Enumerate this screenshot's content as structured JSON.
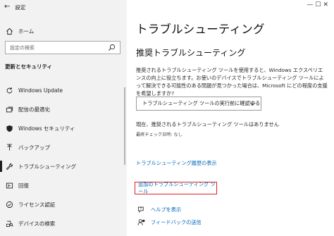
{
  "window": {
    "title": "設定",
    "back_glyph": "←",
    "controls": [
      "—",
      "☐",
      "✕"
    ]
  },
  "sidebar": {
    "home_label": "ホーム",
    "search_placeholder": "設定の検索",
    "section_title": "更新とセキュリティ",
    "items": [
      {
        "label": "Windows Update",
        "icon": "refresh-icon"
      },
      {
        "label": "配信の最適化",
        "icon": "delivery-optimization-icon"
      },
      {
        "label": "Windows セキュリティ",
        "icon": "shield-icon"
      },
      {
        "label": "バックアップ",
        "icon": "backup-upload-icon"
      },
      {
        "label": "トラブルシューティング",
        "icon": "wrench-icon",
        "selected": true
      },
      {
        "label": "回復",
        "icon": "recovery-icon"
      },
      {
        "label": "ライセンス認証",
        "icon": "activation-check-icon"
      },
      {
        "label": "デバイスの検索",
        "icon": "find-device-icon"
      }
    ]
  },
  "main": {
    "title": "トラブルシューティング",
    "recommended_heading": "推奨トラブルシューティング",
    "description": "推奨されるトラブルシューティング ツールを使用すると、Windows エクスペリエンスの向上に役立ちます。お使いのデバイスでトラブルシューティング ツールによって解決できる可能性のある問題が見つかった場合は、Microsoft にどの程度の支援を希望しますか?",
    "dropdown_value": "トラブルシューティング ツールの実行前に確認する",
    "status": "現在、推奨されるトラブルシューティング ツールはありません",
    "last_checked": "最終チェック日時: なし",
    "history_link": "トラブルシューティング履歴の表示",
    "additional_link": "追加のトラブルシューティング ツール",
    "help_link": "ヘルプを表示",
    "feedback_link": "フィードバックの送信"
  },
  "colors": {
    "sidebar_bg": "#f2f2f2",
    "link": "#0067b8",
    "highlight_border": "#e02020"
  }
}
